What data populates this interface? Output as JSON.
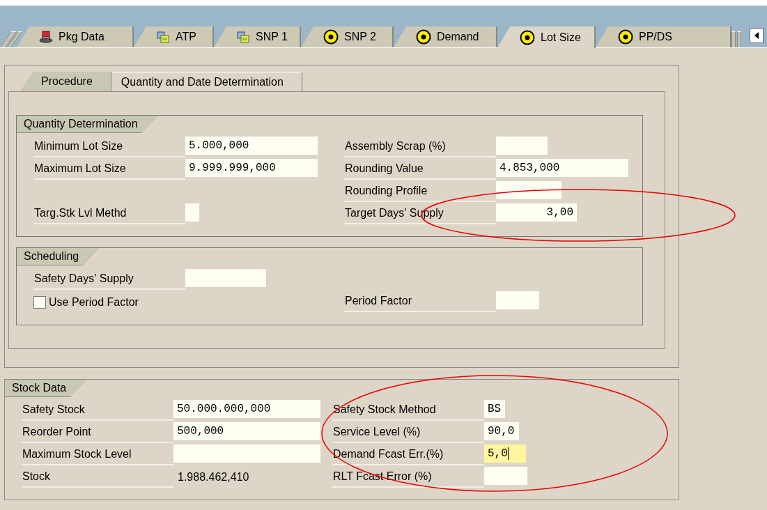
{
  "tabs": [
    {
      "label": "Pkg Data",
      "kind": "hat",
      "selected": false
    },
    {
      "label": "ATP",
      "kind": "stack",
      "selected": false
    },
    {
      "label": "SNP 1",
      "kind": "stack",
      "selected": false
    },
    {
      "label": "SNP 2",
      "kind": "target",
      "selected": false
    },
    {
      "label": "Demand",
      "kind": "target",
      "selected": false
    },
    {
      "label": "Lot Size",
      "kind": "target",
      "selected": true
    },
    {
      "label": "PP/DS",
      "kind": "target",
      "selected": false
    }
  ],
  "subtabs": [
    {
      "label": "Procedure",
      "selected": false
    },
    {
      "label": "Quantity and Date Determination",
      "selected": true
    }
  ],
  "quantity_determination": {
    "title": "Quantity Determination",
    "rows": [
      {
        "left": {
          "kind": "input",
          "label": "Minimum Lot Size",
          "value": "5.000,000"
        },
        "right": {
          "kind": "input",
          "label": "Assembly Scrap (%)"
        }
      },
      {
        "left": {
          "kind": "input",
          "label": "Maximum Lot Size",
          "value": "9.999.999,000"
        },
        "right": {
          "kind": "input",
          "label": "Rounding Value",
          "value": "4.853,000"
        }
      },
      {
        "right": {
          "kind": "input",
          "label": "Rounding Profile"
        }
      },
      {
        "left": {
          "kind": "input",
          "label": "Targ.Stk Lvl Methd"
        },
        "right": {
          "kind": "number",
          "label": "Target Days' Supply",
          "value": "3,00"
        }
      }
    ]
  },
  "scheduling": {
    "title": "Scheduling",
    "rows": [
      {
        "left": {
          "kind": "input",
          "label": "Safety Days' Supply"
        }
      },
      {
        "left": {
          "kind": "checkbox",
          "label": "Use Period Factor",
          "checked": false
        },
        "right": {
          "kind": "input",
          "label": "Period Factor"
        }
      }
    ]
  },
  "stock_data": {
    "title": "Stock Data",
    "rows": [
      {
        "left": {
          "kind": "input",
          "label": "Safety Stock",
          "value": "50.000.000,000"
        },
        "right": {
          "kind": "input",
          "label": "Safety Stock Method",
          "value": "BS"
        }
      },
      {
        "left": {
          "kind": "input",
          "label": "Reorder Point",
          "value": "500,000"
        },
        "right": {
          "kind": "input",
          "label": "Service Level (%)",
          "value": "90,0"
        }
      },
      {
        "left": {
          "kind": "input",
          "label": "Maximum Stock Level"
        },
        "right": {
          "kind": "input",
          "label": "Demand Fcast Err.(%)",
          "value": "5,0",
          "focused": true
        }
      },
      {
        "left": {
          "kind": "display",
          "label": "Stock",
          "value": "1.988.462,410"
        },
        "right": {
          "kind": "input",
          "label": "RLT Fcast Error (%)"
        }
      }
    ]
  }
}
